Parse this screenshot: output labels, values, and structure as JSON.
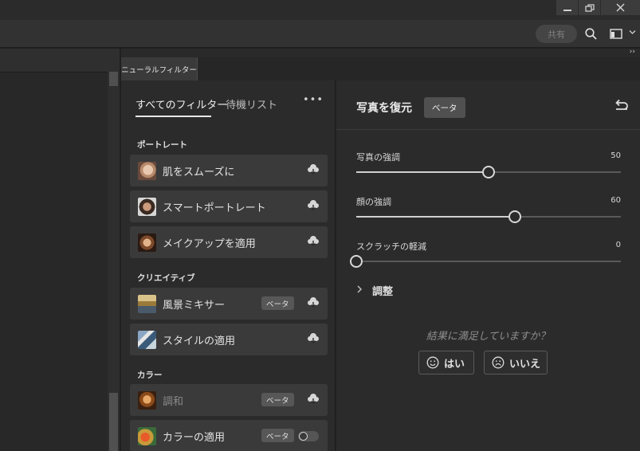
{
  "optionsbar": {
    "share_label": "共有"
  },
  "panel": {
    "tab_label": "ニューラルフィルター"
  },
  "filters": {
    "tab_all": "すべてのフィルター",
    "tab_waitlist": "待機リスト",
    "more_label": "•••",
    "sections": [
      {
        "title": "ポートレート",
        "items": [
          {
            "label": "肌をスムーズに",
            "badge": ""
          },
          {
            "label": "スマートポートレート",
            "badge": ""
          },
          {
            "label": "メイクアップを適用",
            "badge": ""
          }
        ]
      },
      {
        "title": "クリエイティブ",
        "items": [
          {
            "label": "風景ミキサー",
            "badge": "ベータ"
          },
          {
            "label": "スタイルの適用",
            "badge": ""
          }
        ]
      },
      {
        "title": "カラー",
        "items": [
          {
            "label": "調和",
            "badge": "ベータ"
          },
          {
            "label": "カラーの適用",
            "badge": "ベータ"
          }
        ]
      }
    ]
  },
  "detail": {
    "title": "写真を復元",
    "badge": "ベータ",
    "sliders": [
      {
        "label": "写真の強調",
        "value": 50,
        "max": 100
      },
      {
        "label": "顔の強調",
        "value": 60,
        "max": 100
      },
      {
        "label": "スクラッチの軽減",
        "value": 0,
        "max": 100
      }
    ],
    "adjust_label": "調整",
    "feedback_question": "結果に満足していますか？",
    "yes_label": "はい",
    "no_label": "いいえ"
  }
}
